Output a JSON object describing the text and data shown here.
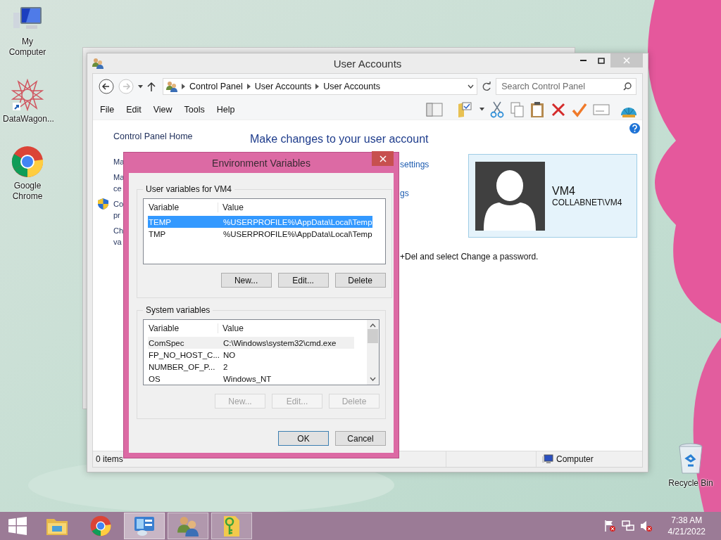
{
  "desktop_icons_left": [
    {
      "label": "My Computer",
      "kind": "computer"
    },
    {
      "label": "DataWagon...",
      "kind": "star"
    },
    {
      "label": "Google Chrome",
      "kind": "chrome"
    }
  ],
  "desktop_icons_right": [
    {
      "label": "Recycle Bin",
      "kind": "bin"
    }
  ],
  "window": {
    "title": "User Accounts",
    "breadcrumbs": [
      "Control Panel",
      "User Accounts",
      "User Accounts"
    ],
    "search": {
      "placeholder": "Search Control Panel"
    },
    "menu": [
      "File",
      "Edit",
      "View",
      "Tools",
      "Help"
    ],
    "sidebar": {
      "home": "Control Panel Home",
      "items": [
        {
          "lines": [
            "Ma"
          ],
          "shield": false
        },
        {
          "lines": [
            "Ma",
            "ce"
          ],
          "shield": false
        },
        {
          "lines": [
            "Co",
            "pr"
          ],
          "shield": true
        },
        {
          "lines": [
            "Ch",
            "va"
          ],
          "shield": false
        }
      ]
    },
    "heading": "Make changes to your user account",
    "links": [
      "settings",
      "gs"
    ],
    "note": "+Del and select Change a password.",
    "account": {
      "name": "VM4",
      "domain": "COLLABNET\\VM4"
    },
    "status_bar": {
      "items": "0 items",
      "location": "Computer"
    }
  },
  "dialog": {
    "title": "Environment Variables",
    "groups": [
      {
        "label": "User variables for VM4",
        "scrollbar": false,
        "columns": [
          "Variable",
          "Value"
        ],
        "rows": [
          {
            "variable": "TEMP",
            "value": "%USERPROFILE%\\AppData\\Local\\Temp",
            "selected": true,
            "hot": false
          },
          {
            "variable": "TMP",
            "value": "%USERPROFILE%\\AppData\\Local\\Temp",
            "selected": false,
            "hot": false
          }
        ],
        "buttons": [
          {
            "label": "New...",
            "disabled": false
          },
          {
            "label": "Edit...",
            "disabled": false
          },
          {
            "label": "Delete",
            "disabled": false
          }
        ]
      },
      {
        "label": "System variables",
        "scrollbar": true,
        "columns": [
          "Variable",
          "Value"
        ],
        "rows": [
          {
            "variable": "ComSpec",
            "value": "C:\\Windows\\system32\\cmd.exe",
            "selected": false,
            "hot": true
          },
          {
            "variable": "FP_NO_HOST_C...",
            "value": "NO",
            "selected": false,
            "hot": false
          },
          {
            "variable": "NUMBER_OF_P...",
            "value": "2",
            "selected": false,
            "hot": false
          },
          {
            "variable": "OS",
            "value": "Windows_NT",
            "selected": false,
            "hot": false
          }
        ],
        "buttons": [
          {
            "label": "New...",
            "disabled": true
          },
          {
            "label": "Edit...",
            "disabled": true
          },
          {
            "label": "Delete",
            "disabled": true
          }
        ]
      }
    ],
    "buttons": [
      {
        "label": "OK",
        "default": true
      },
      {
        "label": "Cancel",
        "default": false
      }
    ]
  },
  "taskbar": {
    "apps": [
      {
        "kind": "explorer",
        "open": false,
        "selected": false
      },
      {
        "kind": "chrome",
        "open": false,
        "selected": false
      },
      {
        "kind": "control-panel",
        "open": true,
        "selected": true
      },
      {
        "kind": "users",
        "open": true,
        "selected": false
      },
      {
        "kind": "key-folder",
        "open": true,
        "selected": false
      }
    ],
    "time": "7:38 AM",
    "date": "4/21/2022"
  }
}
